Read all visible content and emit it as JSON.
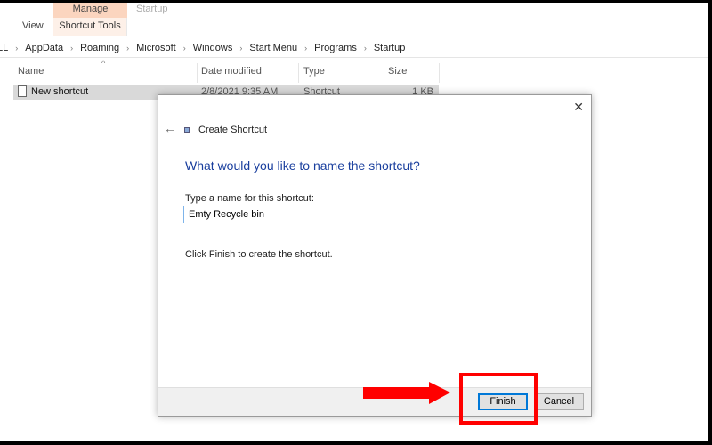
{
  "ribbon": {
    "contextual_group": "Manage",
    "view_tab": "View",
    "shortcut_tools_tab": "Shortcut Tools",
    "window_title": "Startup",
    "accent": "#fbd5bf"
  },
  "breadcrumb": [
    "LL",
    "AppData",
    "Roaming",
    "Microsoft",
    "Windows",
    "Start Menu",
    "Programs",
    "Startup"
  ],
  "columns": {
    "name": "Name",
    "date": "Date modified",
    "type": "Type",
    "size": "Size"
  },
  "files": [
    {
      "name": "New shortcut",
      "date": "2/8/2021 9:35 AM",
      "type": "Shortcut",
      "size": "1 KB"
    }
  ],
  "dialog": {
    "title": "Create Shortcut",
    "heading": "What would you like to name the shortcut?",
    "field_label": "Type a name for this shortcut:",
    "field_value": "Emty Recycle bin",
    "instruction": "Click Finish to create the shortcut.",
    "finish_label": "Finish",
    "cancel_label": "Cancel",
    "heading_color": "#1a3f9e"
  },
  "annotation": {
    "color": "#ff0000"
  }
}
